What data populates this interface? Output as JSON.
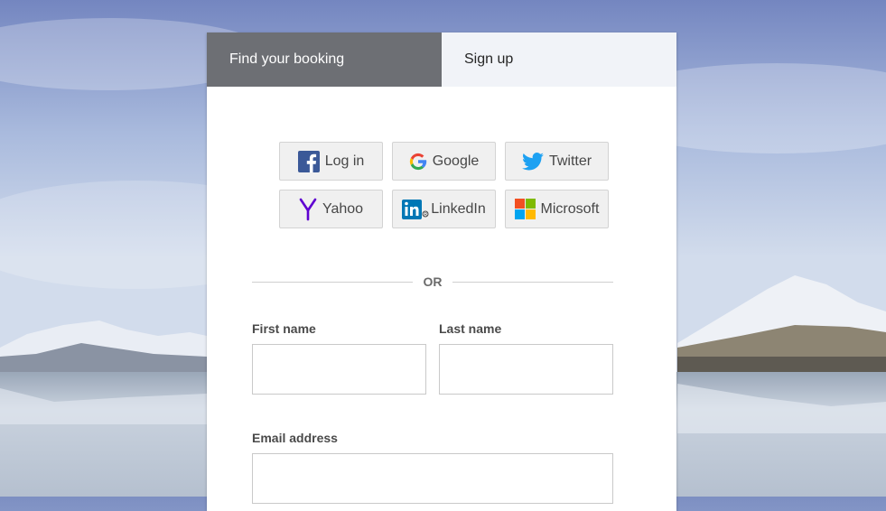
{
  "tabs": {
    "find_booking": "Find your booking",
    "sign_up": "Sign up"
  },
  "social": [
    {
      "label": "Log in",
      "icon": "facebook-icon"
    },
    {
      "label": "Google",
      "icon": "google-icon"
    },
    {
      "label": "Twitter",
      "icon": "twitter-icon"
    },
    {
      "label": "Yahoo",
      "icon": "yahoo-icon"
    },
    {
      "label": "LinkedIn",
      "icon": "linkedin-icon"
    },
    {
      "label": "Microsoft",
      "icon": "microsoft-icon"
    }
  ],
  "divider": "OR",
  "form": {
    "first_name_label": "First name",
    "first_name_value": "",
    "last_name_label": "Last name",
    "last_name_value": "",
    "email_label": "Email address",
    "email_value": ""
  },
  "colors": {
    "tab_active_bg": "#6d6f74",
    "tab_inactive_bg": "#f1f3f8",
    "facebook": "#3b5998",
    "twitter": "#1da1f2",
    "yahoo": "#5f01d1",
    "linkedin": "#0077b5"
  }
}
